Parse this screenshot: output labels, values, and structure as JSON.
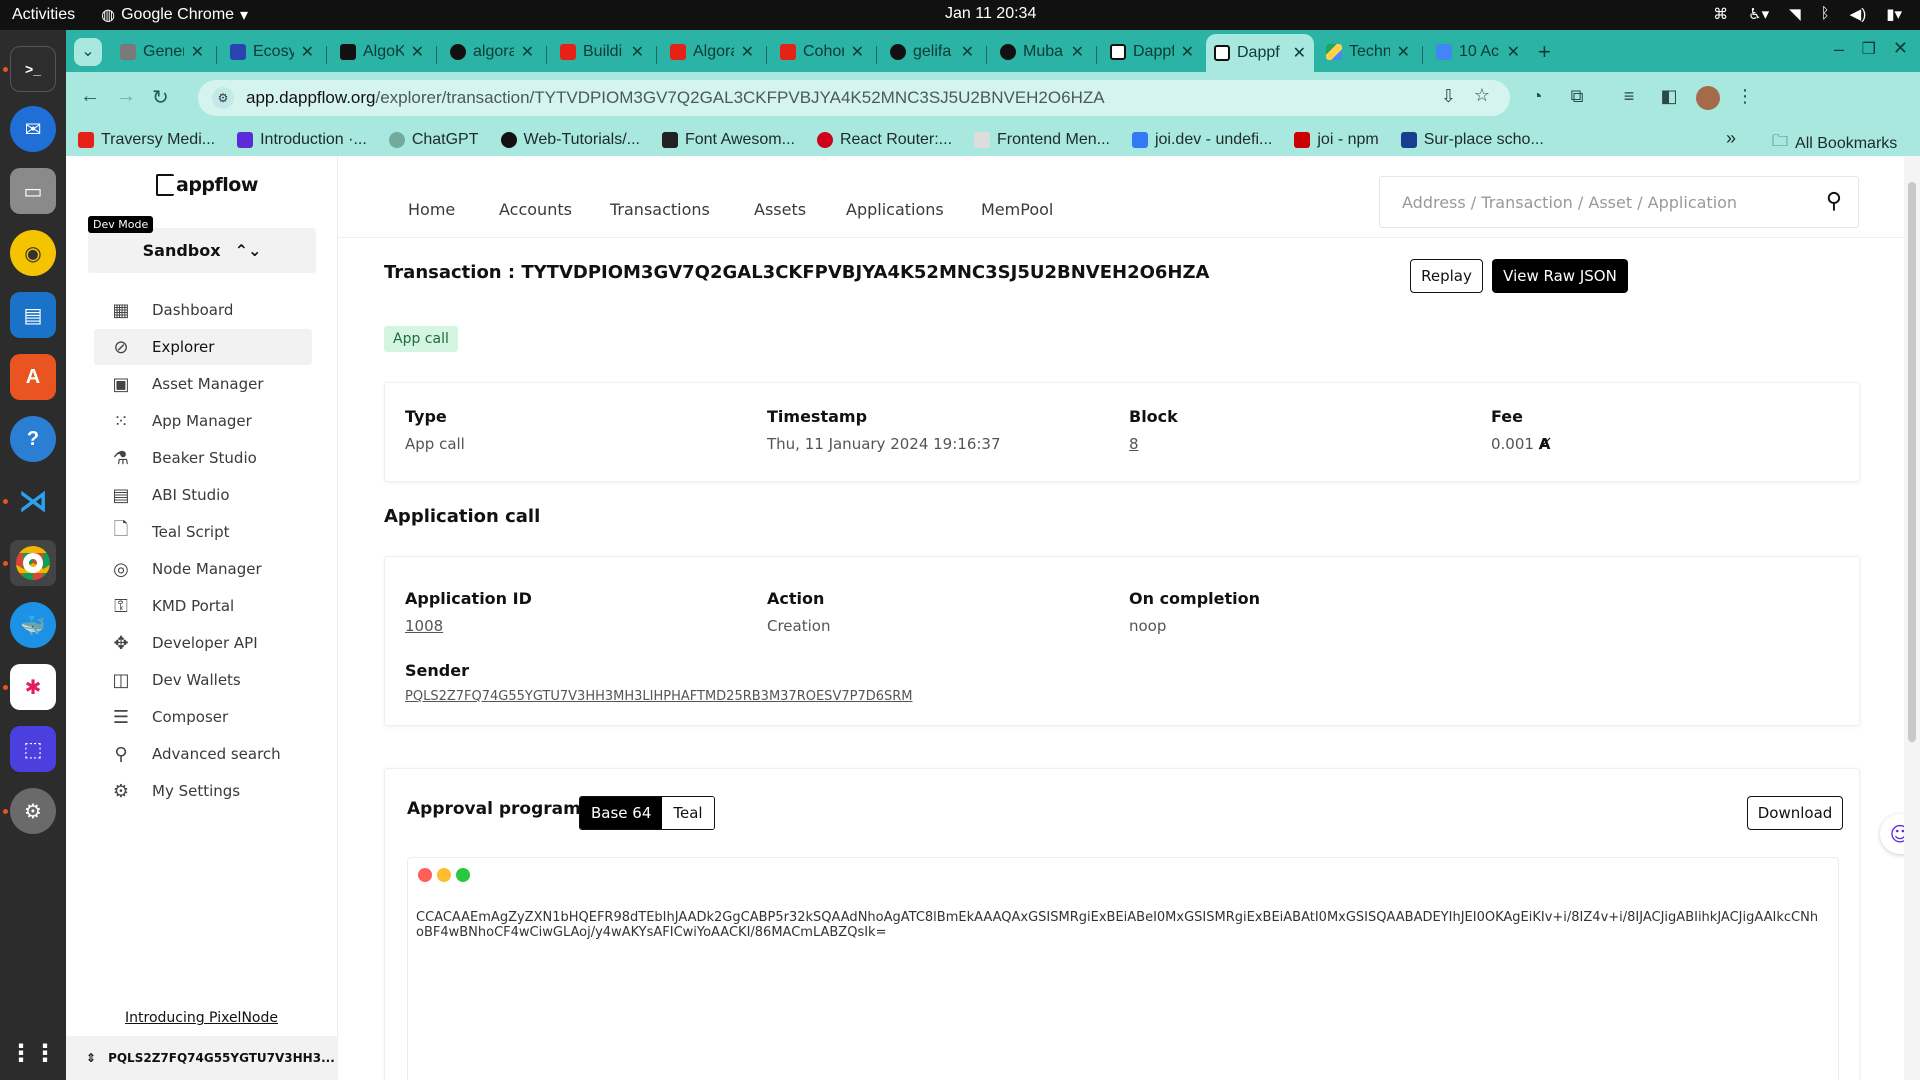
{
  "system": {
    "activities": "Activities",
    "app_name": "Google Chrome",
    "clock": "Jan 11  20:34"
  },
  "dock": {
    "apps": [
      "terminal",
      "thunderbird",
      "files",
      "rhythmbox",
      "writer",
      "app-center",
      "help",
      "vscode",
      "chrome",
      "docker",
      "slack",
      "screenshot",
      "settings"
    ]
  },
  "browser": {
    "tabs": [
      {
        "title": "Gener",
        "color": "#7a7a7a"
      },
      {
        "title": "Ecosys",
        "color": "#2946b0"
      },
      {
        "title": "AlgoK",
        "color": "#111111"
      },
      {
        "title": "algora",
        "color": "#111111"
      },
      {
        "title": "Buildi",
        "color": "#e62117"
      },
      {
        "title": "Algora",
        "color": "#e62117"
      },
      {
        "title": "Cohor",
        "color": "#e62117"
      },
      {
        "title": "gelifa",
        "color": "#111111"
      },
      {
        "title": "Mubar",
        "color": "#111111"
      },
      {
        "title": "Dappf",
        "color": "#111111"
      },
      {
        "title": "Dappf",
        "color": "#111111"
      },
      {
        "title": "Techn",
        "color": "#1fa463"
      },
      {
        "title": "10 Ac",
        "color": "#4285f4"
      }
    ],
    "url_host": "app.dappflow.org",
    "url_path": "/explorer/transaction/TYTVDPIOM3GV7Q2GAL3CKFPVBJYA4K52MNC3SJ5U2BNVEH2O6HZA",
    "bookmarks": [
      {
        "label": "Traversy Medi...",
        "color": "#e62117"
      },
      {
        "label": "Introduction ·...",
        "color": "#5b2bd8"
      },
      {
        "label": "ChatGPT",
        "color": "#74aa9c"
      },
      {
        "label": "Web-Tutorials/...",
        "color": "#111111"
      },
      {
        "label": "Font Awesom...",
        "color": "#222222"
      },
      {
        "label": "React Router:...",
        "color": "#d0021b"
      },
      {
        "label": "Frontend Men...",
        "color": "#cccccc"
      },
      {
        "label": "joi.dev - undefi...",
        "color": "#3478f6"
      },
      {
        "label": "joi - npm",
        "color": "#cb0000"
      },
      {
        "label": "Sur-place scho...",
        "color": "#1a3d8f"
      }
    ],
    "all_bookmarks": "All Bookmarks"
  },
  "sidebar": {
    "brand": "appflow",
    "dev_mode": "Dev Mode",
    "network": "Sandbox",
    "items": [
      {
        "label": "Dashboard",
        "icon": "dashboard-icon"
      },
      {
        "label": "Explorer",
        "icon": "compass-icon"
      },
      {
        "label": "Asset Manager",
        "icon": "asset-icon"
      },
      {
        "label": "App Manager",
        "icon": "grid-icon"
      },
      {
        "label": "Beaker Studio",
        "icon": "beaker-icon"
      },
      {
        "label": "ABI Studio",
        "icon": "abi-icon"
      },
      {
        "label": "Teal Script",
        "icon": "file-icon"
      },
      {
        "label": "Node Manager",
        "icon": "node-icon"
      },
      {
        "label": "KMD Portal",
        "icon": "key-icon"
      },
      {
        "label": "Developer API",
        "icon": "api-icon"
      },
      {
        "label": "Dev Wallets",
        "icon": "wallet-icon"
      },
      {
        "label": "Composer",
        "icon": "list-icon"
      },
      {
        "label": "Advanced search",
        "icon": "search-icon"
      },
      {
        "label": "My Settings",
        "icon": "gear-icon"
      }
    ],
    "pixelnode_link": "Introducing PixelNode",
    "account": "PQLS2Z7FQ74G55YGTU7V3HH3..."
  },
  "topnav": {
    "links": [
      "Home",
      "Accounts",
      "Transactions",
      "Assets",
      "Applications",
      "MemPool"
    ],
    "search_placeholder": "Address / Transaction / Asset / Application"
  },
  "transaction": {
    "title": "Transaction : TYTVDPIOM3GV7Q2GAL3CKFPVBJYA4K52MNC3SJ5U2BNVEH2O6HZA",
    "replay": "Replay",
    "view_raw": "View Raw JSON",
    "badge": "App call",
    "type_label": "Type",
    "type_value": "App call",
    "timestamp_label": "Timestamp",
    "timestamp_value": "Thu, 11 January 2024 19:16:37",
    "block_label": "Block",
    "block_value": "8",
    "fee_label": "Fee",
    "fee_value": "0.001"
  },
  "application_call": {
    "heading": "Application call",
    "app_id_label": "Application ID",
    "app_id_value": "1008",
    "action_label": "Action",
    "action_value": "Creation",
    "on_completion_label": "On completion",
    "on_completion_value": "noop",
    "sender_label": "Sender",
    "sender_value": "PQLS2Z7FQ74G55YGTU7V3HH3MH3LIHPHAFTMD25RB3M37ROESV7P7D6SRM"
  },
  "approval_program": {
    "title": "Approval program",
    "formats": [
      "Base 64",
      "Teal"
    ],
    "selected_format": "Base 64",
    "download": "Download",
    "code": "CCACAAEmAgZyZXN1bHQEFR98dTEbIhJAADk2GgCABP5r32kSQAAdNhoAgATC8lBmEkAAAQAxGSISMRgiExBEiABeI0MxGSISMRgiExBEiABAtI0MxGSISQAABADEYIhJEI0OKAgEiKIv+i/8IZ4v+i/8IJACJigABIihkJACJigAAIkcCNhoBF4wBNhoCF4wCiwGLAoj/y4wAKYsAFICwiYoAACKI/86MACmLABZQsIk="
  }
}
